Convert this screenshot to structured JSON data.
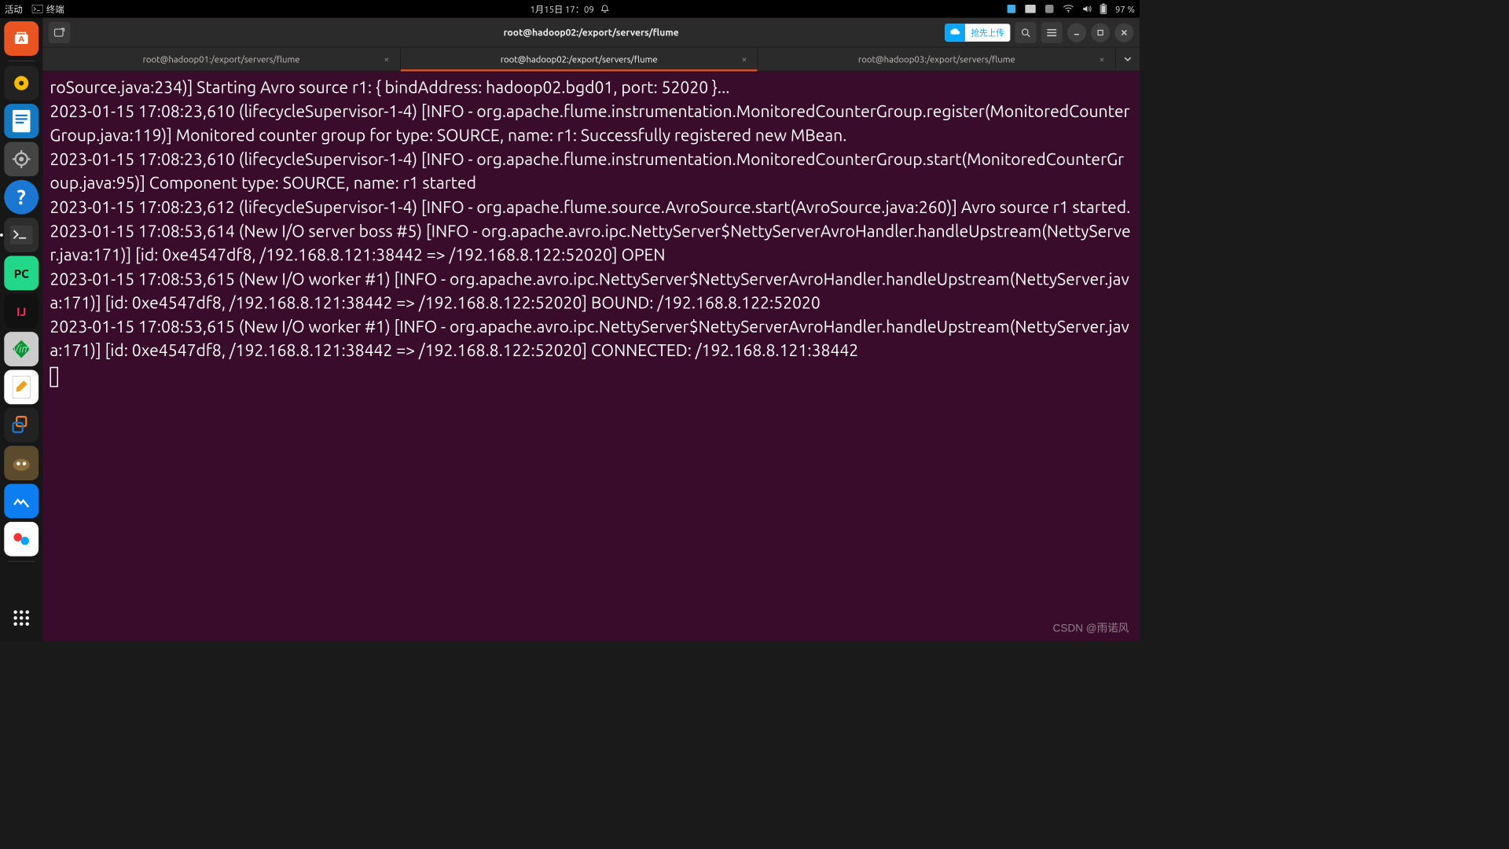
{
  "top_panel": {
    "activities": "活动",
    "app_name": "终端",
    "datetime": "1月15日  17：09",
    "battery": "97 %"
  },
  "dock": {
    "pycharm": "PC",
    "idea": "IJ"
  },
  "window": {
    "title": "root@hadoop02:/export/servers/flume"
  },
  "upload": {
    "label": "抢先上传"
  },
  "tabs": [
    {
      "label": "root@hadoop01:/export/servers/flume",
      "active": false
    },
    {
      "label": "root@hadoop02:/export/servers/flume",
      "active": true
    },
    {
      "label": "root@hadoop03:/export/servers/flume",
      "active": false
    }
  ],
  "terminal": {
    "text": "roSource.java:234)] Starting Avro source r1: { bindAddress: hadoop02.bgd01, port: 52020 }...\n2023-01-15 17:08:23,610 (lifecycleSupervisor-1-4) [INFO - org.apache.flume.instrumentation.MonitoredCounterGroup.register(MonitoredCounterGroup.java:119)] Monitored counter group for type: SOURCE, name: r1: Successfully registered new MBean.\n2023-01-15 17:08:23,610 (lifecycleSupervisor-1-4) [INFO - org.apache.flume.instrumentation.MonitoredCounterGroup.start(MonitoredCounterGroup.java:95)] Component type: SOURCE, name: r1 started\n2023-01-15 17:08:23,612 (lifecycleSupervisor-1-4) [INFO - org.apache.flume.source.AvroSource.start(AvroSource.java:260)] Avro source r1 started.\n2023-01-15 17:08:53,614 (New I/O server boss #5) [INFO - org.apache.avro.ipc.NettyServer$NettyServerAvroHandler.handleUpstream(NettyServer.java:171)] [id: 0xe4547df8, /192.168.8.121:38442 => /192.168.8.122:52020] OPEN\n2023-01-15 17:08:53,615 (New I/O worker #1) [INFO - org.apache.avro.ipc.NettyServer$NettyServerAvroHandler.handleUpstream(NettyServer.java:171)] [id: 0xe4547df8, /192.168.8.121:38442 => /192.168.8.122:52020] BOUND: /192.168.8.122:52020\n2023-01-15 17:08:53,615 (New I/O worker #1) [INFO - org.apache.avro.ipc.NettyServer$NettyServerAvroHandler.handleUpstream(NettyServer.java:171)] [id: 0xe4547df8, /192.168.8.121:38442 => /192.168.8.122:52020] CONNECTED: /192.168.8.121:38442"
  },
  "watermark": "CSDN @雨诺风"
}
